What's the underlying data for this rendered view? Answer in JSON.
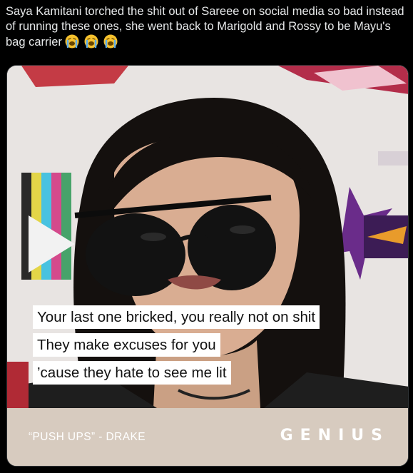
{
  "tweet": {
    "text": "Saya Kamitani torched the shit out of Sareee on social media so bad instead of running these ones, she went back to Marigold and Rossy to be Mayu's bag carrier",
    "emojis": [
      "loudly-crying-face",
      "loudly-crying-face",
      "loudly-crying-face"
    ]
  },
  "media": {
    "lyrics": [
      "Your last one bricked, you really not on shit",
      "They make excuses for you",
      "’cause they hate to see me lit"
    ],
    "song_credit": "“PUSH UPS” - DRAKE",
    "brand": "GENIUS"
  },
  "colors": {
    "background": "#000000",
    "text": "#e7e9ea",
    "card_footer": "#d7cbbf",
    "lyric_box": "#ffffff"
  }
}
